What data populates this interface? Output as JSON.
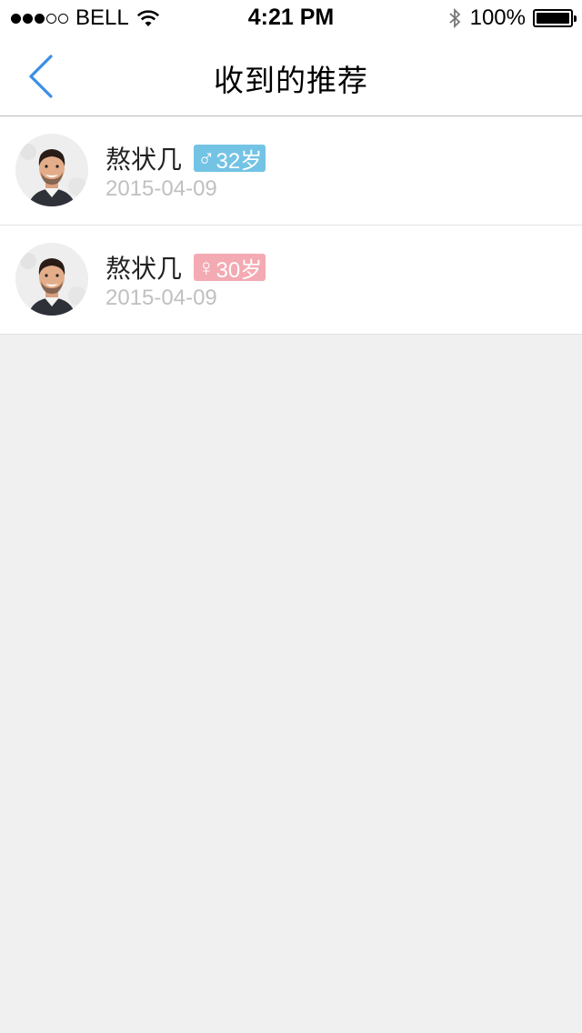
{
  "status_bar": {
    "carrier": "BELL",
    "time": "4:21 PM",
    "battery": "100%",
    "signal_filled": 3,
    "signal_total": 5
  },
  "nav": {
    "title": "收到的推荐",
    "back_icon": "chevron-left-icon"
  },
  "colors": {
    "accent": "#3a8ee6",
    "male_badge": "#73c3e5",
    "female_badge": "#f4aab2",
    "date_text": "#c0c0c0",
    "background": "#f0f0f0"
  },
  "recommendations": [
    {
      "name": "熬状几",
      "gender": "male",
      "gender_symbol": "♂",
      "age": "32岁",
      "date": "2015-04-09",
      "avatar_icon": "avatar-photo"
    },
    {
      "name": "熬状几",
      "gender": "female",
      "gender_symbol": "♀",
      "age": "30岁",
      "date": "2015-04-09",
      "avatar_icon": "avatar-photo"
    }
  ]
}
